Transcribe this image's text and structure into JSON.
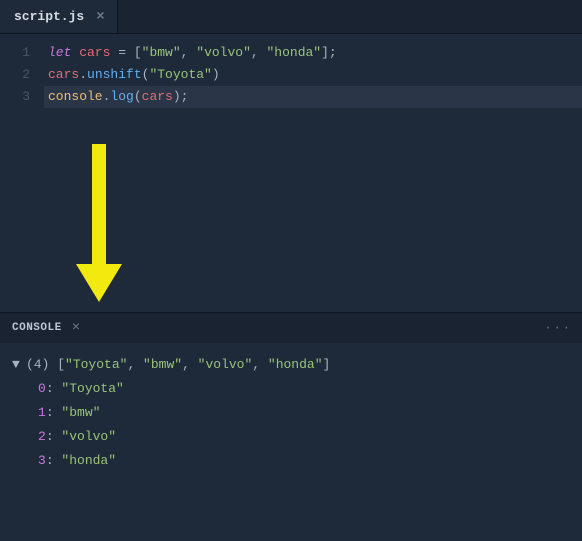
{
  "editor": {
    "tab": {
      "label": "script.js"
    },
    "lines": [
      {
        "n": "1"
      },
      {
        "n": "2"
      },
      {
        "n": "3"
      }
    ],
    "code": {
      "l1_let": "let",
      "l1_cars": " cars ",
      "l1_eq": "= ",
      "l1_b1": "[",
      "l1_s1": "\"bmw\"",
      "l1_c1": ", ",
      "l1_s2": "\"volvo\"",
      "l1_c2": ", ",
      "l1_s3": "\"honda\"",
      "l1_b2": "];",
      "l2_var": "cars",
      "l2_dot": ".",
      "l2_fn": "unshift",
      "l2_p1": "(",
      "l2_arg": "\"Toyota\"",
      "l2_p2": ")",
      "l3_obj": "console",
      "l3_dot": ".",
      "l3_fn": "log",
      "l3_p1": "(",
      "l3_arg": "cars",
      "l3_p2": ");"
    }
  },
  "arrow_color": "#f2e90e",
  "consolePanel": {
    "title": "CONSOLE",
    "more": "···",
    "output": {
      "caret": "▼",
      "count": "(4)",
      "summary_open": " [",
      "s1": "\"Toyota\"",
      "sep": ", ",
      "s2": "\"bmw\"",
      "s3": "\"volvo\"",
      "s4": "\"honda\"",
      "summary_close": "]",
      "items": [
        {
          "idx": "0",
          "val": "\"Toyota\""
        },
        {
          "idx": "1",
          "val": "\"bmw\""
        },
        {
          "idx": "2",
          "val": "\"volvo\""
        },
        {
          "idx": "3",
          "val": "\"honda\""
        }
      ]
    }
  }
}
